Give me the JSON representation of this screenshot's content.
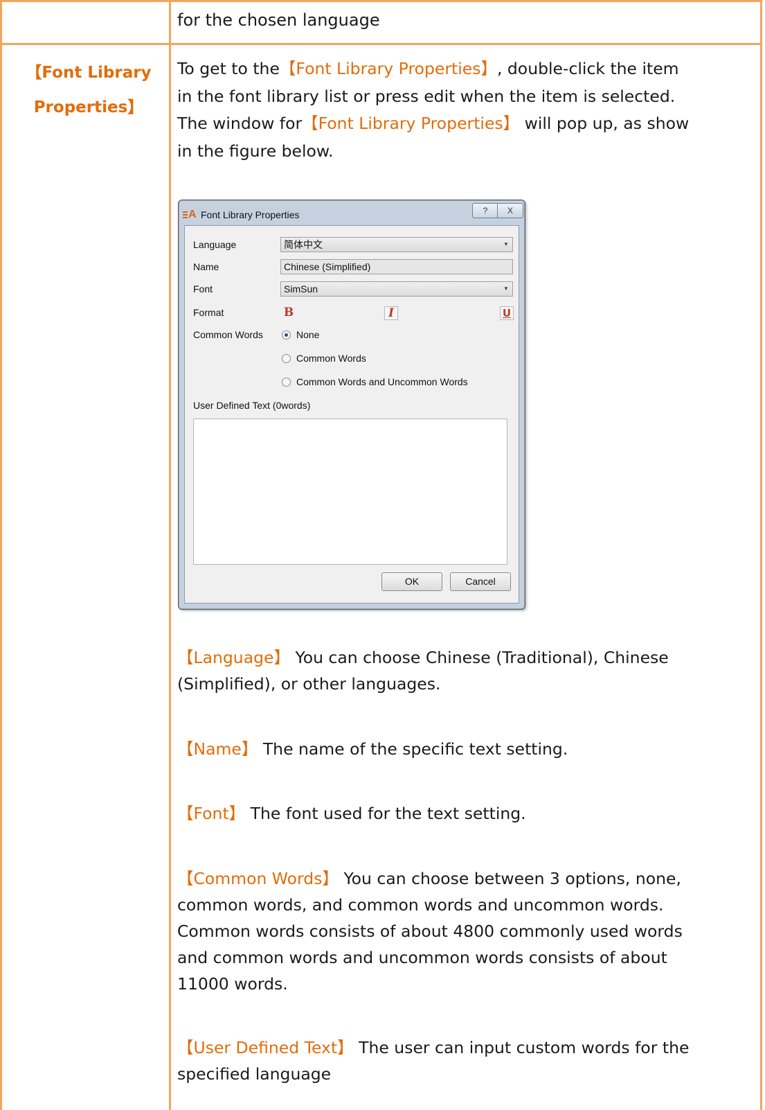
{
  "intro_row": {
    "text": "for the chosen language"
  },
  "row_label": {
    "open": "【",
    "title_line1": "Font Library",
    "title_line2": "Properties",
    "close": "】"
  },
  "intro": {
    "p1_before": "To get to the",
    "p1_term": "【Font Library Properties】",
    "p1_after": ", double-click the item",
    "p2": "in the font library list or press edit when the item is selected.",
    "p3_before": "The window for",
    "p3_term": "【Font Library Properties】",
    "p3_after": "will pop up, as show",
    "p4": "in the figure below."
  },
  "dialog": {
    "title": "Font Library Properties",
    "icon": "font-library-icon",
    "help_glyph": "?",
    "close_glyph": "X",
    "language_label": "Language",
    "language_value": "简体中文",
    "name_label": "Name",
    "name_value": "Chinese (Simplified)",
    "font_label": "Font",
    "font_value": "SimSun",
    "format_label": "Format",
    "bold_glyph": "B",
    "italic_glyph": "I",
    "underline_glyph": "U",
    "common_words_label": "Common Words",
    "options": [
      "None",
      "Common Words",
      "Common Words and Uncommon Words"
    ],
    "selected_option": "None",
    "user_text_label": "User Defined Text (0words)",
    "ok_label": "OK",
    "cancel_label": "Cancel"
  },
  "descriptions": [
    {
      "term": "【Language】",
      "text": " You can choose Chinese (Traditional), Chinese",
      "cont": "(Simplified), or other languages."
    },
    {
      "term": "【Name】",
      "text": " The name of the specific text setting."
    },
    {
      "term": "【Font】",
      "text": " The font used for the text setting."
    },
    {
      "term": "【Common Words】",
      "text": " You can choose between 3 options, none,",
      "cont": "common words, and common words and uncommon words.",
      "cont2": "Common words consists of about 4800 commonly used words",
      "cont3": "and common words and uncommon words consists of about",
      "cont4": "11000 words."
    },
    {
      "term": "【User Defined Text】",
      "text": " The user can input custom words for the",
      "cont": "specified language"
    }
  ],
  "colors": {
    "accent": "#e36c0a",
    "border": "#f3a45f",
    "dialog_frame": "#c5d1df"
  }
}
